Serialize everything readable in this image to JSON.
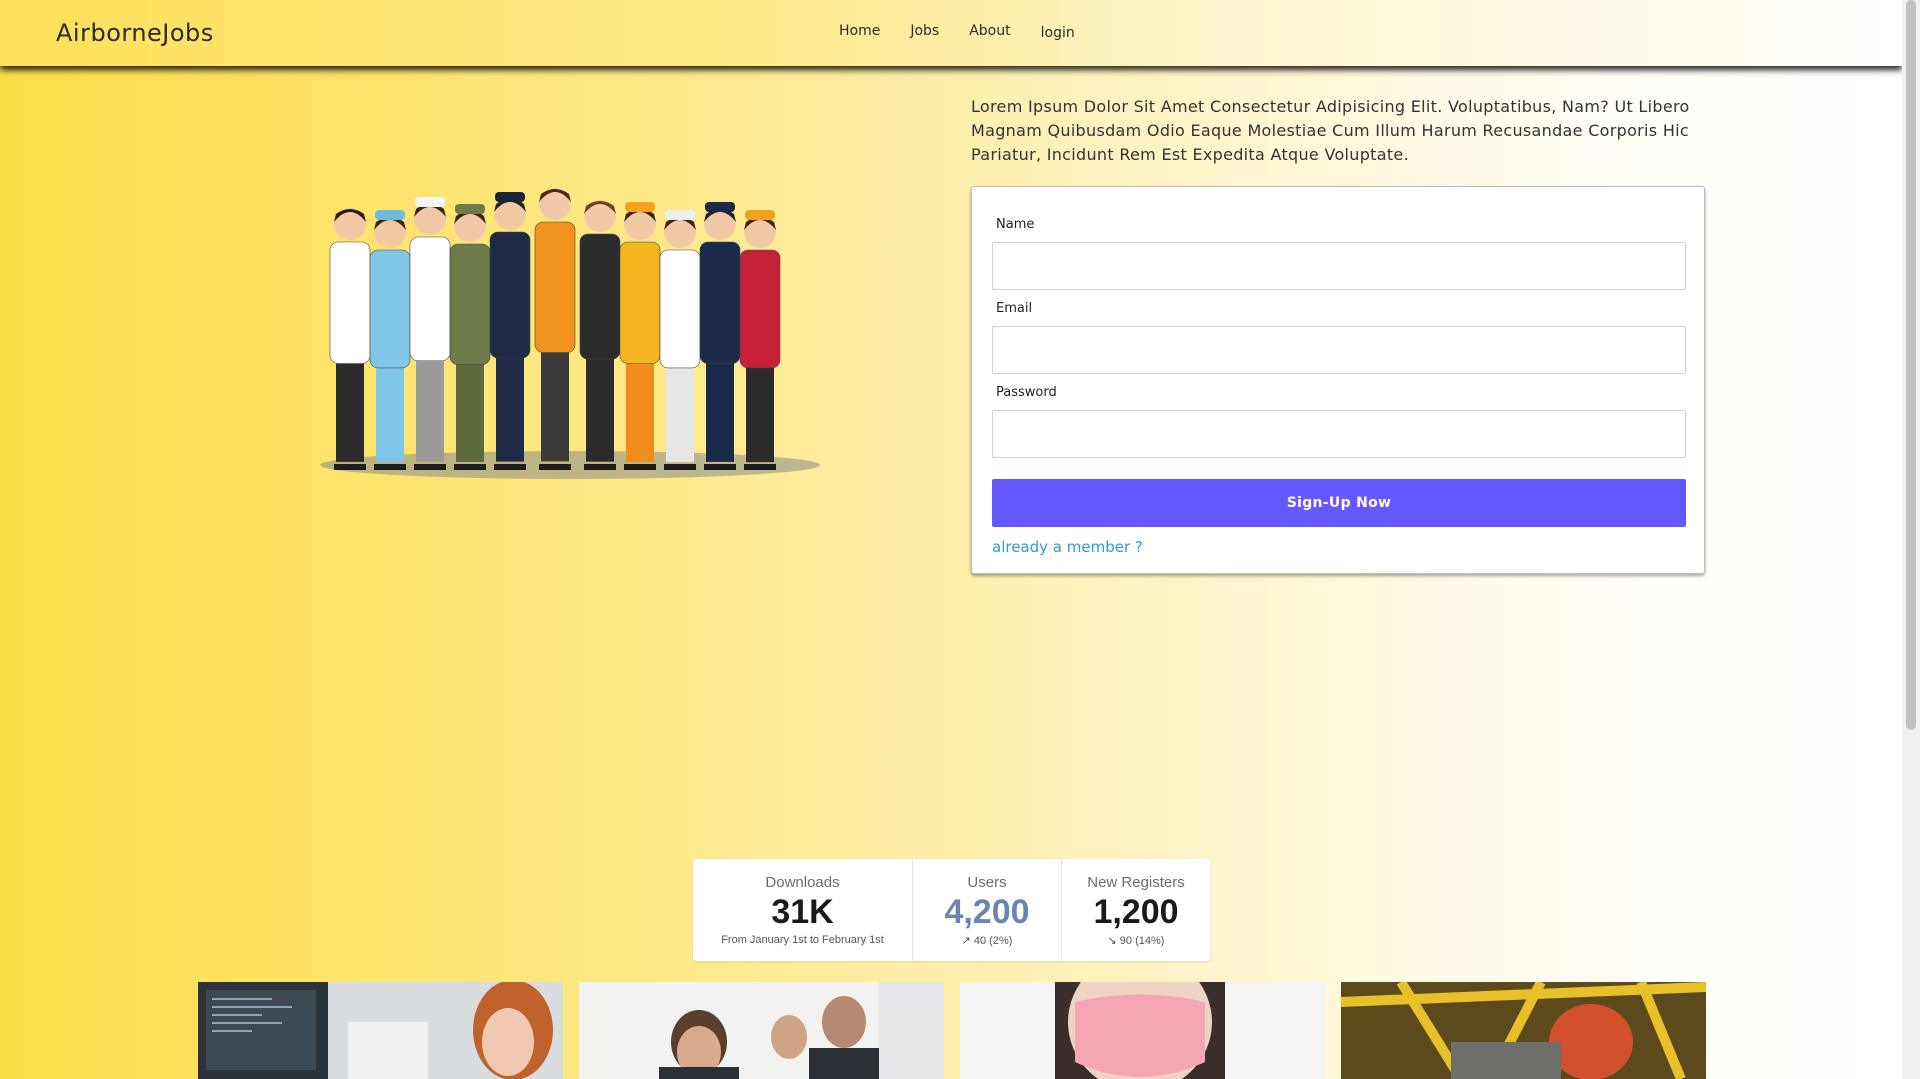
{
  "nav": {
    "brand": "AirborneJobs",
    "links": [
      {
        "label": "Home"
      },
      {
        "label": "Jobs"
      },
      {
        "label": "About"
      },
      {
        "label": "login"
      }
    ]
  },
  "hero": {
    "intro": "Lorem Ipsum Dolor Sit Amet Consectetur Adipisicing Elit. Voluptatibus, Nam? Ut Libero Magnam Quibusdam Odio Eaque Molestiae Cum Illum Harum Recusandae Corporis Hic Pariatur, Incidunt Rem Est Expedita Atque Voluptate.",
    "illustration": "group-of-workers-illustration"
  },
  "form": {
    "name_label": "Name",
    "name_value": "",
    "email_label": "Email",
    "email_value": "",
    "password_label": "Password",
    "password_value": "",
    "submit_label": "Sign-Up Now",
    "member_link": "already a member ?"
  },
  "stats": [
    {
      "title": "Downloads",
      "value": "31K",
      "desc": "From January 1st to February 1st"
    },
    {
      "title": "Users",
      "value": "4,200",
      "desc": "↗︎ 40 (2%)"
    },
    {
      "title": "New Registers",
      "value": "1,200",
      "desc": "↘︎ 90 (14%)"
    }
  ],
  "photos": [
    {
      "name": "office-worker-photo"
    },
    {
      "name": "business-meeting-photo"
    },
    {
      "name": "medical-mask-photo"
    },
    {
      "name": "construction-worker-photo"
    }
  ],
  "colors": {
    "accent": "#6658ff",
    "link": "#2e9bd6",
    "stat_accent": "#6a86b0"
  }
}
